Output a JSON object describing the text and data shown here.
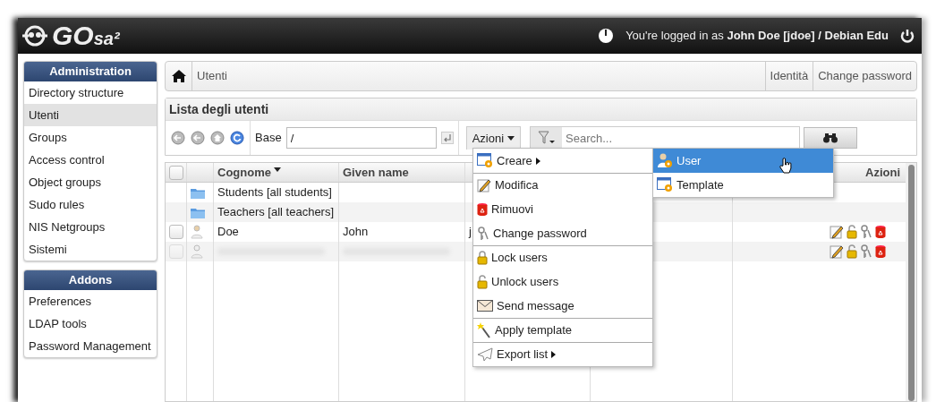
{
  "header": {
    "logo_main": "GO",
    "logo_suffix": "sa²",
    "login_text": "You're logged in as **John Doe [jdoe] / Debian Edu**"
  },
  "sidebar": [
    {
      "title": "Administration",
      "items": [
        {
          "label": "Directory structure",
          "selected": false
        },
        {
          "label": "Utenti",
          "selected": true
        },
        {
          "label": "Groups",
          "selected": false
        },
        {
          "label": "Access control",
          "selected": false
        },
        {
          "label": "Object groups",
          "selected": false
        },
        {
          "label": "Sudo rules",
          "selected": false
        },
        {
          "label": "NIS Netgroups",
          "selected": false
        },
        {
          "label": "Sistemi",
          "selected": false
        }
      ]
    },
    {
      "title": "Addons",
      "items": [
        {
          "label": "Preferences",
          "selected": false
        },
        {
          "label": "LDAP tools",
          "selected": false
        },
        {
          "label": "Password Management",
          "selected": false
        }
      ]
    }
  ],
  "breadcrumb": {
    "current": "Utenti",
    "links": [
      "Identità",
      "Change password"
    ]
  },
  "list": {
    "title": "Lista degli utenti",
    "base_label": "Base",
    "base_value": "/",
    "actions_button": "Azioni",
    "search_placeholder": "Search..."
  },
  "table": {
    "header_checked": false,
    "columns": [
      {
        "label": "Cognome",
        "sorted": true
      },
      {
        "label": "Given name",
        "sorted": false
      },
      {
        "label": "Azioni",
        "sorted": false
      }
    ],
    "rows": [
      {
        "kind": "folder",
        "name": "Students [all students]"
      },
      {
        "kind": "folder",
        "name": "Teachers [all teachers]"
      },
      {
        "kind": "user",
        "checked": false,
        "surname": "Doe",
        "given_name": "John",
        "column_3": "j"
      },
      {
        "kind": "obscured",
        "checked": false
      }
    ]
  },
  "menu": {
    "groups": [
      [
        {
          "label": "Creare",
          "kind": "create",
          "submenu": true
        }
      ],
      [
        {
          "label": "Modifica",
          "kind": "edit",
          "submenu": false
        },
        {
          "label": "Rimuovi",
          "kind": "remove",
          "submenu": false
        },
        {
          "label": "Change password",
          "kind": "password",
          "submenu": false
        }
      ],
      [
        {
          "label": "Lock users",
          "kind": "lock",
          "submenu": false
        },
        {
          "label": "Unlock users",
          "kind": "unlock",
          "submenu": false
        },
        {
          "label": "Send message",
          "kind": "message",
          "submenu": false
        }
      ],
      [
        {
          "label": "Apply template",
          "kind": "template",
          "submenu": false
        }
      ],
      [
        {
          "label": "Export list",
          "kind": "export",
          "submenu": true
        }
      ]
    ],
    "submenu": [
      {
        "label": "User",
        "kind": "user",
        "selected": true
      },
      {
        "label": "Template",
        "kind": "template",
        "selected": false
      }
    ]
  }
}
